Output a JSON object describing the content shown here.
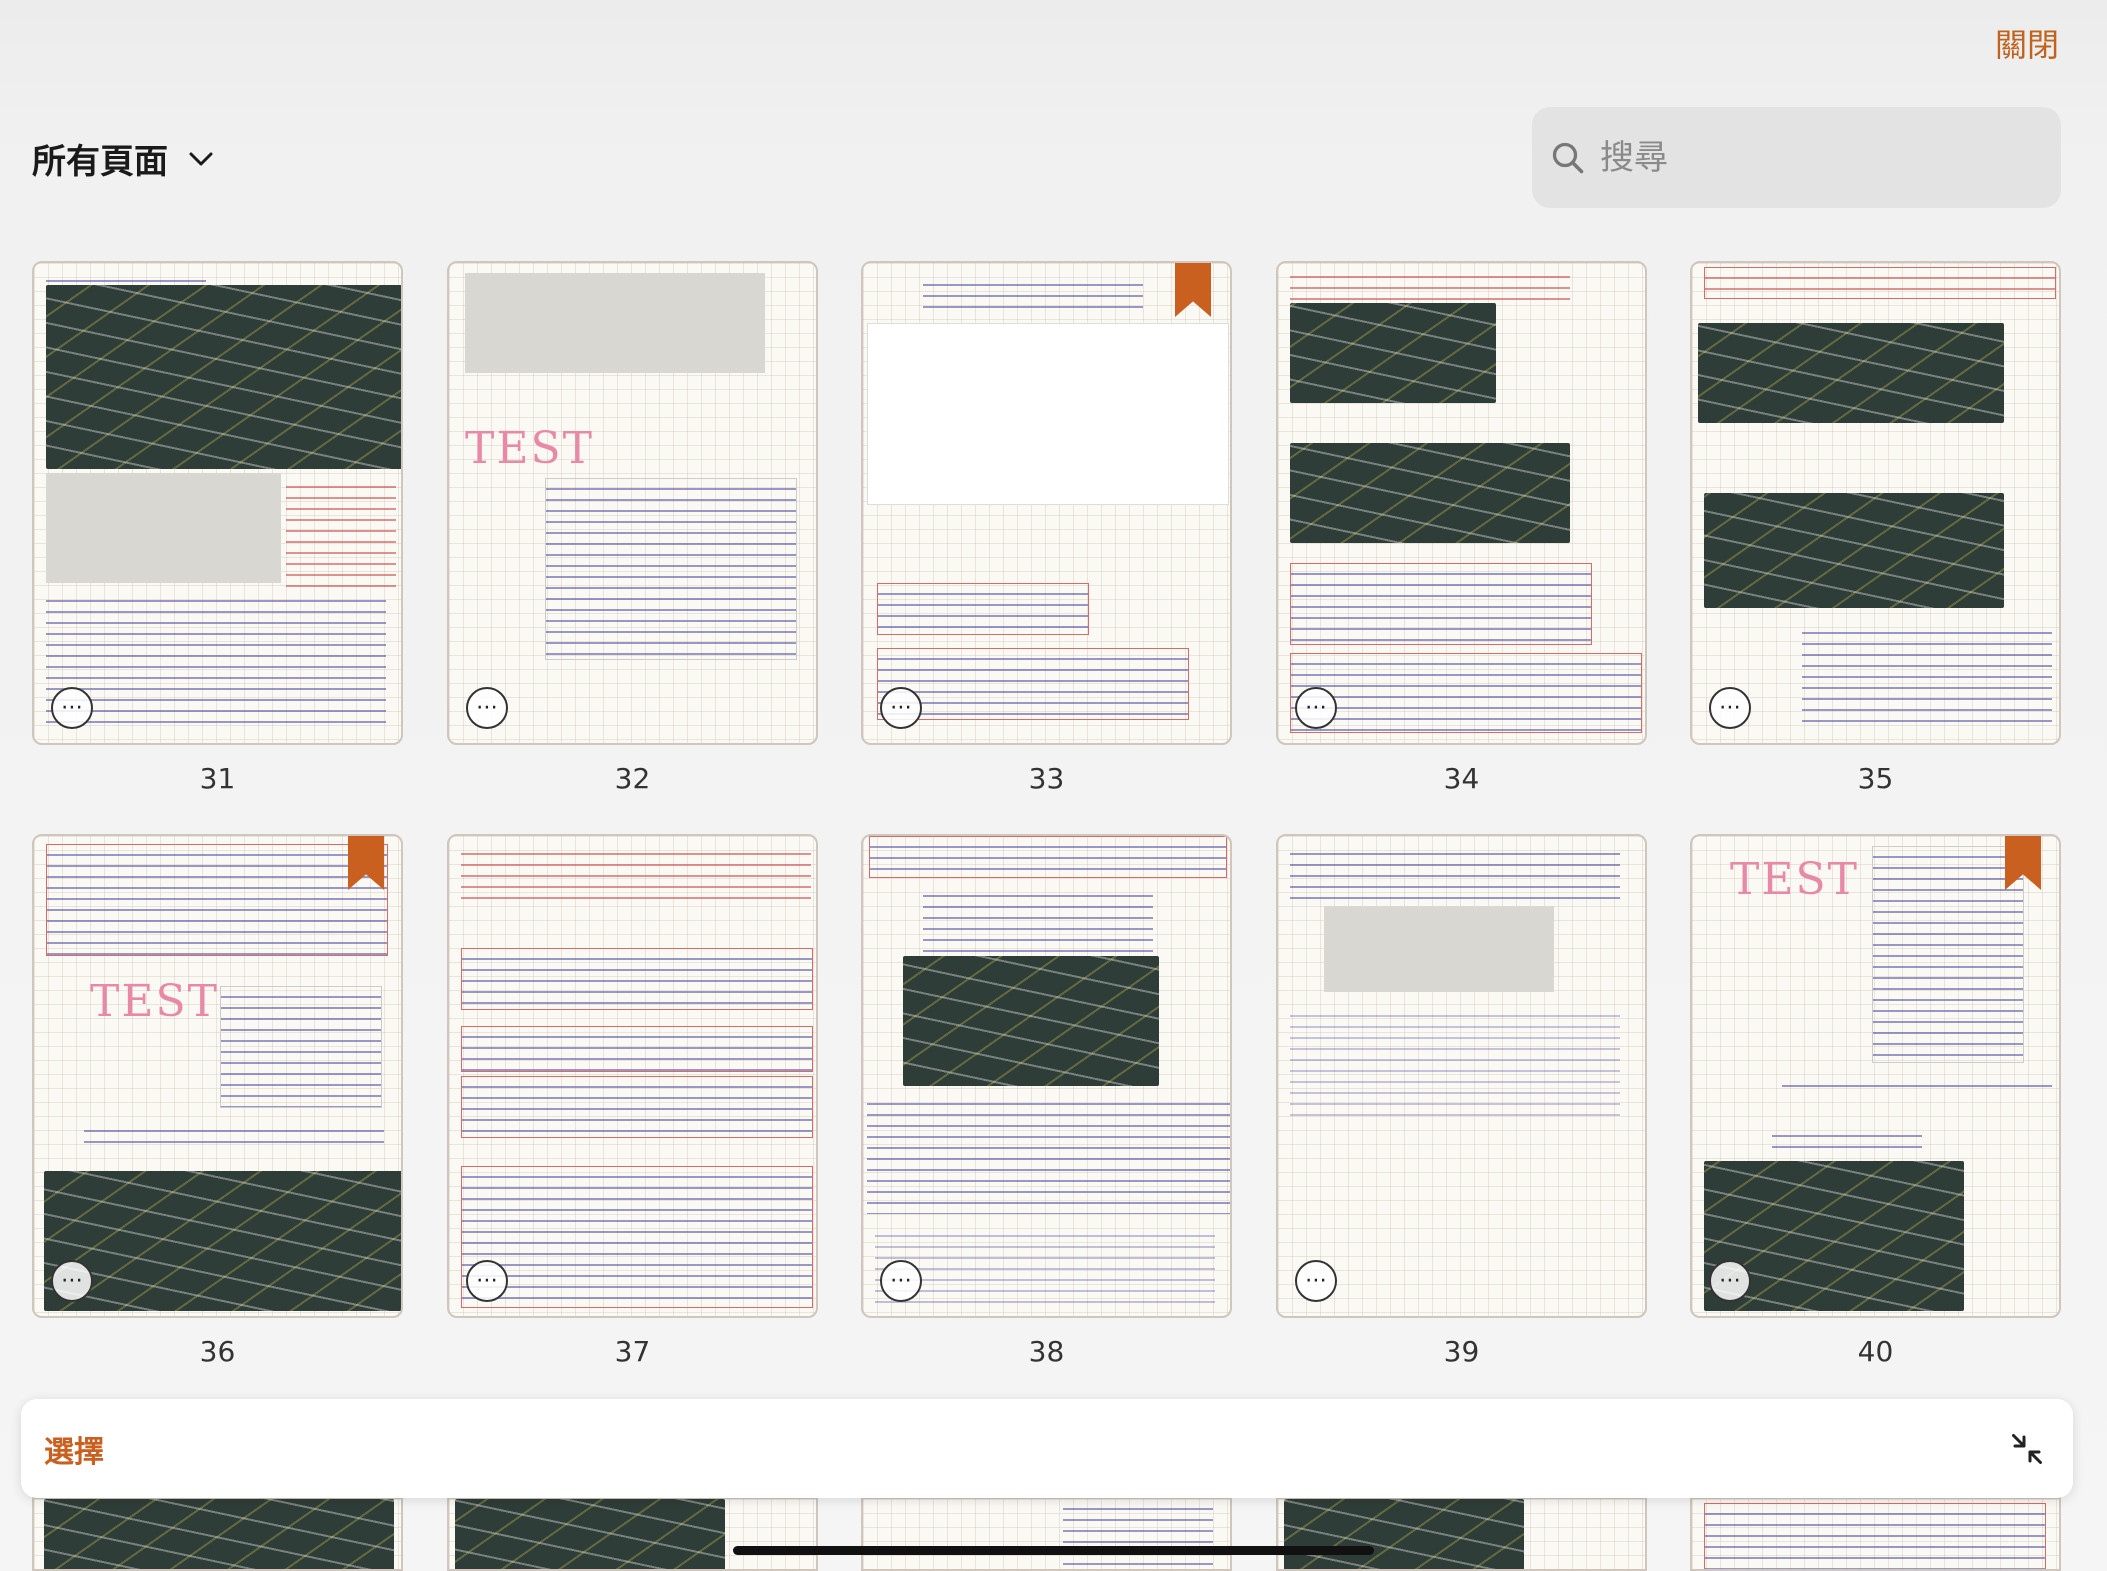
{
  "header": {
    "close_label": "關閉",
    "filter_label": "所有頁面",
    "search_placeholder": "搜尋"
  },
  "pages": [
    {
      "number": "31",
      "bookmarked": false
    },
    {
      "number": "32",
      "bookmarked": false
    },
    {
      "number": "33",
      "bookmarked": true
    },
    {
      "number": "34",
      "bookmarked": false
    },
    {
      "number": "35",
      "bookmarked": false
    },
    {
      "number": "36",
      "bookmarked": true
    },
    {
      "number": "37",
      "bookmarked": false
    },
    {
      "number": "38",
      "bookmarked": false
    },
    {
      "number": "39",
      "bookmarked": false
    },
    {
      "number": "40",
      "bookmarked": true
    }
  ],
  "thumb_text": {
    "test": "TEST"
  },
  "bottom_bar": {
    "select_label": "選擇"
  },
  "colors": {
    "accent": "#c9601f",
    "bookmark": "#c9601f"
  },
  "icons": [
    "chevron-down-icon",
    "search-icon",
    "more-icon",
    "bookmark-icon",
    "collapse-icon"
  ]
}
